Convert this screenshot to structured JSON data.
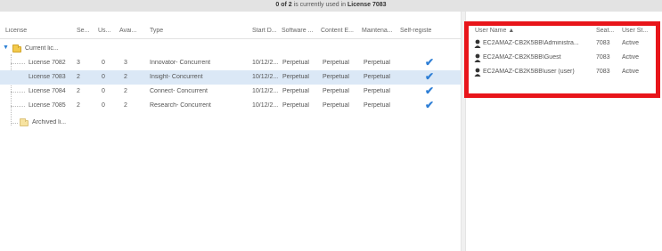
{
  "status": {
    "count": "0 of 2",
    "middle": "is currently used in",
    "license": "License 7083"
  },
  "columns": [
    {
      "key": "license",
      "label": "License"
    },
    {
      "key": "seats",
      "label": "Se..."
    },
    {
      "key": "used",
      "label": "Us..."
    },
    {
      "key": "available",
      "label": "Avai..."
    },
    {
      "key": "type",
      "label": "Type"
    },
    {
      "key": "start",
      "label": "Start D..."
    },
    {
      "key": "software",
      "label": "Software ..."
    },
    {
      "key": "content",
      "label": "Content E..."
    },
    {
      "key": "maintenance",
      "label": "Maintena..."
    },
    {
      "key": "self",
      "label": "Self-registe"
    }
  ],
  "tree": {
    "current_label": "Current lic...",
    "archived_label": "Archived li..."
  },
  "licenses": [
    {
      "name": "License 7082",
      "seats": "3",
      "used": "0",
      "available": "3",
      "type": "Innovator- Concurrent",
      "start": "10/12/2...",
      "software": "Perpetual",
      "content": "Perpetual",
      "maintenance": "Perpetual",
      "self": "✔"
    },
    {
      "name": "License 7083",
      "seats": "2",
      "used": "0",
      "available": "2",
      "type": "Insight- Concurrent",
      "start": "10/12/2...",
      "software": "Perpetual",
      "content": "Perpetual",
      "maintenance": "Perpetual",
      "self": "✔"
    },
    {
      "name": "License 7084",
      "seats": "2",
      "used": "0",
      "available": "2",
      "type": "Connect- Concurrent",
      "start": "10/12/2...",
      "software": "Perpetual",
      "content": "Perpetual",
      "maintenance": "Perpetual",
      "self": "✔"
    },
    {
      "name": "License 7085",
      "seats": "2",
      "used": "0",
      "available": "2",
      "type": "Research- Concurrent",
      "start": "10/12/2...",
      "software": "Perpetual",
      "content": "Perpetual",
      "maintenance": "Perpetual",
      "self": "✔"
    }
  ],
  "selected_license": "License 7083",
  "users_columns": [
    {
      "key": "user",
      "label": "User Name ▲"
    },
    {
      "key": "seat",
      "label": "Seat..."
    },
    {
      "key": "status",
      "label": "User St..."
    }
  ],
  "users": [
    {
      "user": "EC2AMAZ-CB2K5BB\\Administra...",
      "seat": "7083",
      "status": "Active"
    },
    {
      "user": "EC2AMAZ-CB2K5BB\\Guest",
      "seat": "7083",
      "status": "Active"
    },
    {
      "user": "EC2AMAZ-CB2K5BB\\user (user)",
      "seat": "7083",
      "status": "Active"
    }
  ],
  "colors": {
    "highlight": "#e8151a",
    "selected_row": "#dbe8f6",
    "check": "#2f7fd6",
    "folder": "#f2c94c"
  },
  "icons": {
    "folder": "folder-icon",
    "user": "user-icon",
    "check": "checkmark-icon",
    "expander": "expand-arrow-icon"
  }
}
